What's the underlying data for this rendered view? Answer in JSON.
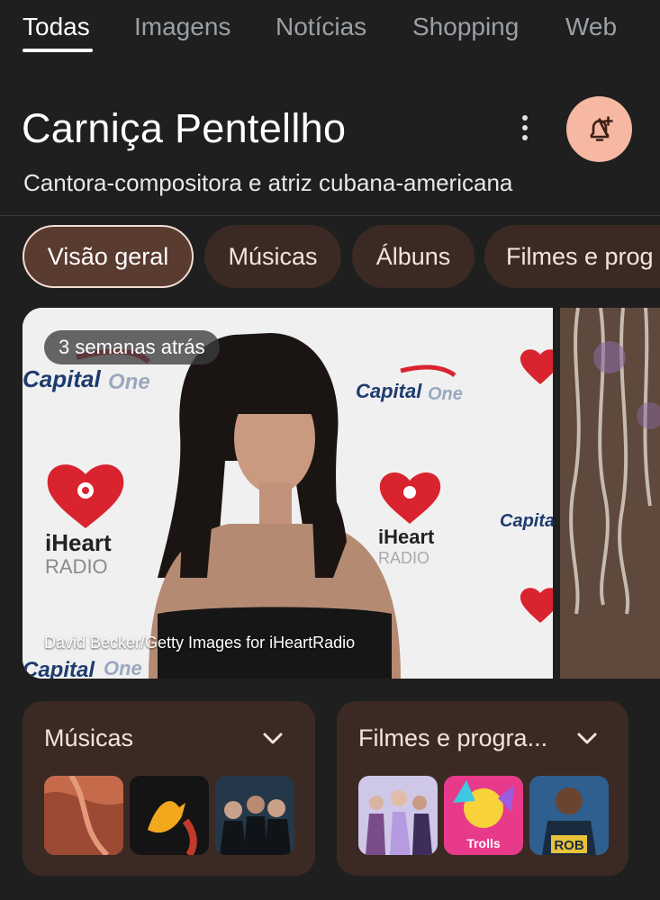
{
  "tabs": [
    {
      "label": "Todas",
      "active": true
    },
    {
      "label": "Imagens",
      "active": false
    },
    {
      "label": "Notícias",
      "active": false
    },
    {
      "label": "Shopping",
      "active": false
    },
    {
      "label": "Web",
      "active": false
    }
  ],
  "entity": {
    "name": "Carniça Pentellho",
    "description": "Cantora-compositora e atriz cubana-americana"
  },
  "chips": [
    {
      "label": "Visão geral",
      "selected": true
    },
    {
      "label": "Músicas",
      "selected": false
    },
    {
      "label": "Álbuns",
      "selected": false
    },
    {
      "label": "Filmes e prog",
      "selected": false
    }
  ],
  "hero": {
    "badge": "3 semanas atrás",
    "credit": "David Becker/Getty Images for iHeartRadio",
    "logo_capital": "Capital",
    "logo_capital_one": "One",
    "logo_iheart": "iHeart",
    "logo_radio": "RADIO"
  },
  "cards": [
    {
      "title": "Músicas"
    },
    {
      "title": "Filmes e progra..."
    }
  ],
  "thumbnail_texts": {
    "trolls": "Trolls",
    "rob": "ROB"
  },
  "icons": {
    "more": "more-vert-icon",
    "bell": "bell-plus-icon",
    "chevron": "chevron-down-icon"
  },
  "colors": {
    "background": "#1f1f1f",
    "chip": "#3b2a23",
    "bell_button": "#f6b8a3"
  }
}
